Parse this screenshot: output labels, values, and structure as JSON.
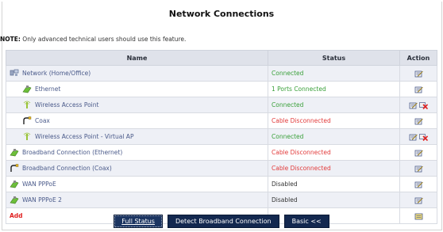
{
  "page": {
    "title": "Network Connections",
    "note_prefix": "NOTE:",
    "note_text": " Only advanced technical users should use this feature."
  },
  "table": {
    "headers": {
      "name": "Name",
      "status": "Status",
      "action": "Action"
    },
    "rows": [
      {
        "name": "Network (Home/Office)",
        "status": "Connected",
        "icon": "network-icon"
      },
      {
        "name": "Ethernet",
        "status": "1 Ports Connected",
        "icon": "ethernet-icon"
      },
      {
        "name": "Wireless Access Point",
        "status": "Connected",
        "icon": "wireless-icon"
      },
      {
        "name": "Coax",
        "status": "Cable Disconnected",
        "icon": "coax-icon"
      },
      {
        "name": "Wireless Access Point - Virtual AP",
        "status": "Connected",
        "icon": "wireless-icon"
      },
      {
        "name": "Broadband Connection (Ethernet)",
        "status": "Cable Disconnected",
        "icon": "ethernet-icon"
      },
      {
        "name": "Broadband Connection (Coax)",
        "status": "Cable Disconnected",
        "icon": "coax-icon"
      },
      {
        "name": "WAN PPPoE",
        "status": "Disabled",
        "icon": "ethernet-icon"
      },
      {
        "name": "WAN PPPoE 2",
        "status": "Disabled",
        "icon": "ethernet-icon"
      }
    ],
    "add_label": "Add"
  },
  "buttons": {
    "full_status": "Full Status",
    "detect": "Detect Broadband Connection",
    "basic": "Basic <<"
  },
  "colors": {
    "connected": "#3aa03a",
    "disconnected": "#e23b3b",
    "header_bg": "#dfe2ea",
    "button_bg": "#13284f"
  }
}
